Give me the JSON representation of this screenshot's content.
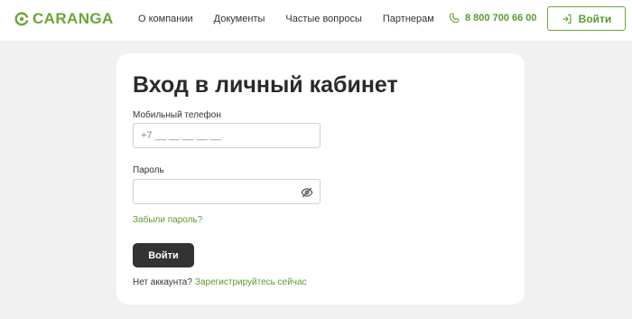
{
  "header": {
    "logo_text": "CARANGA",
    "nav": [
      {
        "label": "О компании"
      },
      {
        "label": "Документы"
      },
      {
        "label": "Частые вопросы"
      },
      {
        "label": "Партнерам"
      }
    ],
    "phone": "8 800 700 66 00",
    "login_label": "Войти"
  },
  "colors": {
    "brand_green": "#6aa637",
    "background": "#f1f1f1",
    "submit_dark": "#333333"
  },
  "form": {
    "title": "Вход в личный кабинет",
    "phone_label": "Мобильный телефон",
    "phone_placeholder": "+7 __ __ __ __ __",
    "phone_value": "",
    "password_label": "Пароль",
    "password_value": "",
    "forgot_label": "Забыли пароль?",
    "submit_label": "Войти",
    "no_account_text": "Нет аккаунта?",
    "register_link": "Зарегистрируйтесь сейчас"
  },
  "icons": {
    "logo": "caranga-logo-icon",
    "phone": "phone-icon",
    "login": "login-arrow-icon",
    "password_toggle": "eye-slash-icon"
  }
}
